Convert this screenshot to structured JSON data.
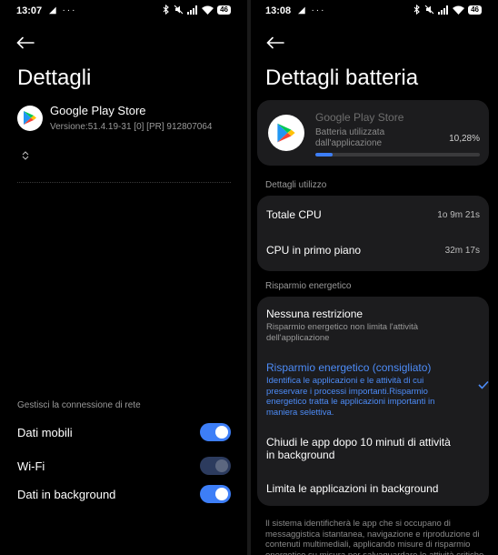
{
  "left": {
    "status": {
      "time": "13:07",
      "left_icons": "◢ ···",
      "battery": "46"
    },
    "title": "Dettagli",
    "app": {
      "name": "Google Play Store",
      "version": "Versione:51.4.19-31 [0] [PR] 912807064"
    },
    "network": {
      "label": "Gestisci la connessione di rete",
      "items": [
        {
          "label": "Dati mobili",
          "on": true
        },
        {
          "label": "Wi-Fi",
          "on": false
        },
        {
          "label": "Dati in background",
          "on": true
        }
      ]
    }
  },
  "right": {
    "status": {
      "time": "13:08",
      "left_icons": "◢ ···",
      "battery": "46"
    },
    "title": "Dettagli batteria",
    "usage": {
      "app_name": "Google Play Store",
      "desc": "Batteria utilizzata dall'applicazione",
      "percent": "10,28%",
      "fraction": 0.1028
    },
    "details": {
      "heading": "Dettagli utilizzo",
      "rows": [
        {
          "label": "Totale CPU",
          "value": "1o 9m 21s"
        },
        {
          "label": "CPU in primo piano",
          "value": "32m 17s"
        }
      ]
    },
    "saver": {
      "heading": "Risparmio energetico",
      "options": [
        {
          "title": "Nessuna restrizione",
          "desc": "Risparmio energetico non limita l'attività dell'applicazione",
          "selected": false
        },
        {
          "title": "Risparmio energetico (consigliato)",
          "desc": "Identifica le applicazioni e le attività di cui preservare i processi importanti.Risparmio energetico tratta le applicazioni importanti in maniera selettiva.",
          "selected": true
        },
        {
          "title": "Chiudi le app dopo 10 minuti di attività in background",
          "desc": "",
          "selected": false
        },
        {
          "title": "Limita le applicazioni in background",
          "desc": "",
          "selected": false
        }
      ]
    },
    "footer": "Il sistema identificherà le app che si occupano di messaggistica istantanea, navigazione e riproduzione di contenuti multimediali, applicando misure di risparmio energetico su misura per salvaguardare le attività critiche"
  },
  "colors": {
    "accent": "#3d7ef7",
    "card": "#1c1c1e",
    "background": "#000000"
  }
}
